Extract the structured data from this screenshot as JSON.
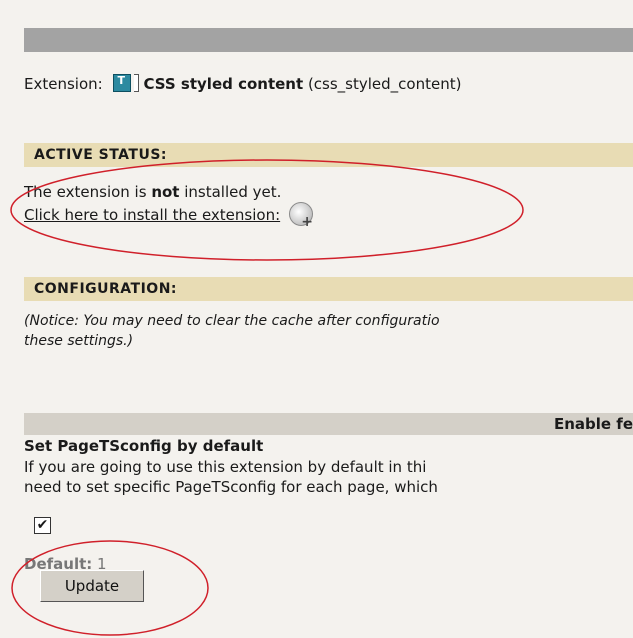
{
  "extension": {
    "label": "Extension:",
    "icon_letter": "T",
    "name": "CSS styled content",
    "key": "(css_styled_content)"
  },
  "active_status": {
    "heading": "ACTIVE STATUS:",
    "line_prefix": "The extension is ",
    "line_bold": "not",
    "line_suffix": " installed yet.",
    "install_link": "Click here to install the extension:"
  },
  "configuration": {
    "heading": "CONFIGURATION:",
    "notice_open": "(",
    "notice_word": "Notice:",
    "notice_text": " You may need to clear the cache after configuratio",
    "notice_line2": "these settings.",
    "notice_close": ")"
  },
  "enable_bar": {
    "label": "Enable fe"
  },
  "setting": {
    "title": "Set PageTSconfig by default",
    "desc_line1": "If you are going to use this extension by default in thi",
    "desc_line2": "need to set specific PageTSconfig for each page, which",
    "checked": true,
    "checkmark": "✔",
    "default_label": "Default:",
    "default_value": "1"
  },
  "update_button": {
    "label": "Update"
  },
  "annotation_color": "#d0202a"
}
